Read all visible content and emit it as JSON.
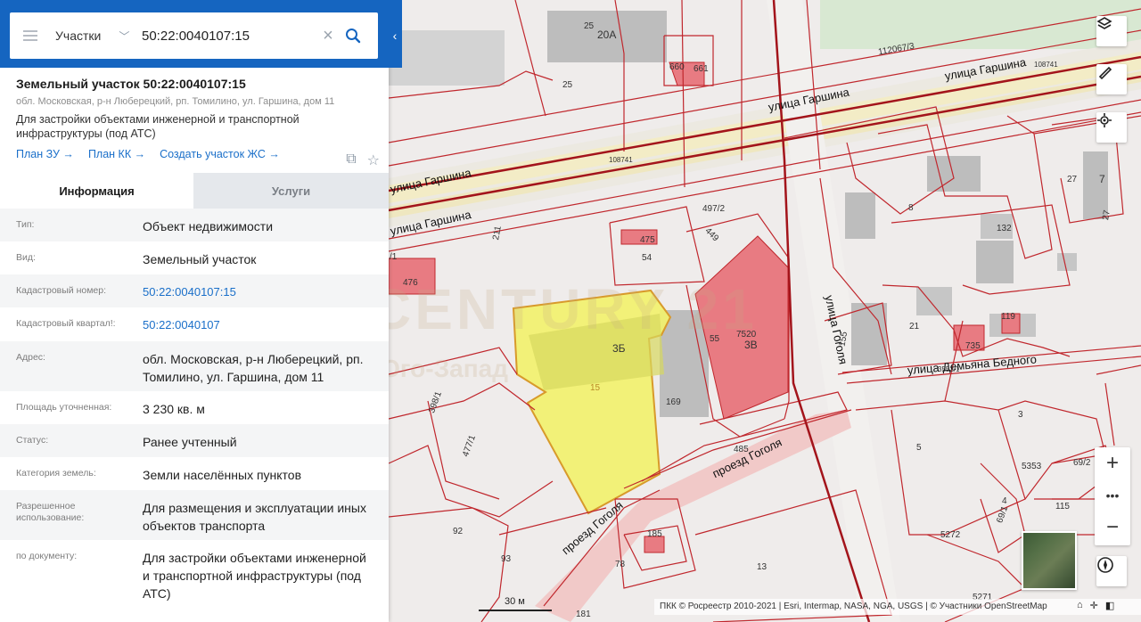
{
  "search": {
    "type_label": "Участки",
    "value": "50:22:0040107:15"
  },
  "parcel": {
    "title": "Земельный участок 50:22:0040107:15",
    "address": "обл. Московская, р-н Люберецкий, рп. Томилино, ул. Гаршина, дом 11",
    "purpose": "Для застройки объектами инженерной и транспортной инфраструктуры (под АТС)",
    "links": [
      "План ЗУ →",
      "План КК →",
      "Создать участок ЖС →"
    ]
  },
  "tabs": [
    "Информация",
    "Услуги"
  ],
  "info_rows": [
    {
      "label": "Тип:",
      "value": "Объект недвижимости"
    },
    {
      "label": "Вид:",
      "value": "Земельный участок"
    },
    {
      "label": "Кадастровый номер:",
      "value": "50:22:0040107:15"
    },
    {
      "label": "Кадастровый квартал!:",
      "value": "50:22:0040107"
    },
    {
      "label": "Адрес:",
      "value": "обл. Московская, р-н Люберецкий, рп. Томилино, ул. Гаршина, дом 11"
    },
    {
      "label": "Площадь уточненная:",
      "value": "3 230 кв. м"
    },
    {
      "label": "Статус:",
      "value": "Ранее учтенный"
    },
    {
      "label": "Категория земель:",
      "value": "Земли населённых пунктов"
    },
    {
      "label": "Разрешенное использование:",
      "value": "Для размещения и эксплуатации иных объектов транспорта"
    },
    {
      "label": "по документу:",
      "value": "Для застройки объектами инженерной и транспортной инфраструктуры (под АТС)"
    }
  ],
  "map": {
    "streets": [
      "улица Гаршина",
      "улица Гаршина",
      "улица Гаршина",
      "улица Гаршина",
      "улица Гоголя",
      "улица Демьяна Бедного",
      "проезд Гоголя",
      "проезд Гоголя"
    ],
    "parcel_labels": [
      "25",
      "20А",
      "660",
      "661",
      "25",
      "112067/3",
      "108741",
      "108741",
      "497/2",
      "475",
      "449",
      "54",
      "211",
      "476",
      "3Б",
      "15",
      "169",
      "55",
      "3В",
      "7520",
      "155",
      "21",
      "735",
      "119",
      "132",
      "8",
      "27",
      "7",
      "27",
      "398/1",
      "477/1",
      "485",
      "3",
      "5",
      "5353",
      "69/2",
      "115",
      "4",
      "69/1",
      "5272",
      "92",
      "93",
      "78",
      "185",
      "13",
      "5271",
      "181",
      "/1",
      "3552/1"
    ],
    "watermark": "CENTURY 21",
    "watermark_sub": "Юго-Запад",
    "scale_label": "30 м",
    "attribution": "ПКК © Росреестр 2010-2021 | Esri, Intermap, NASA, NGA, USGS | © Участники OpenStreetMap"
  },
  "colors": {
    "header_blue": "#1565c0",
    "link_blue": "#1a6fc9",
    "parcel_yellow": "#f3f36a",
    "parcel_border_red": "#c0272d",
    "building_red": "#e06f75"
  }
}
